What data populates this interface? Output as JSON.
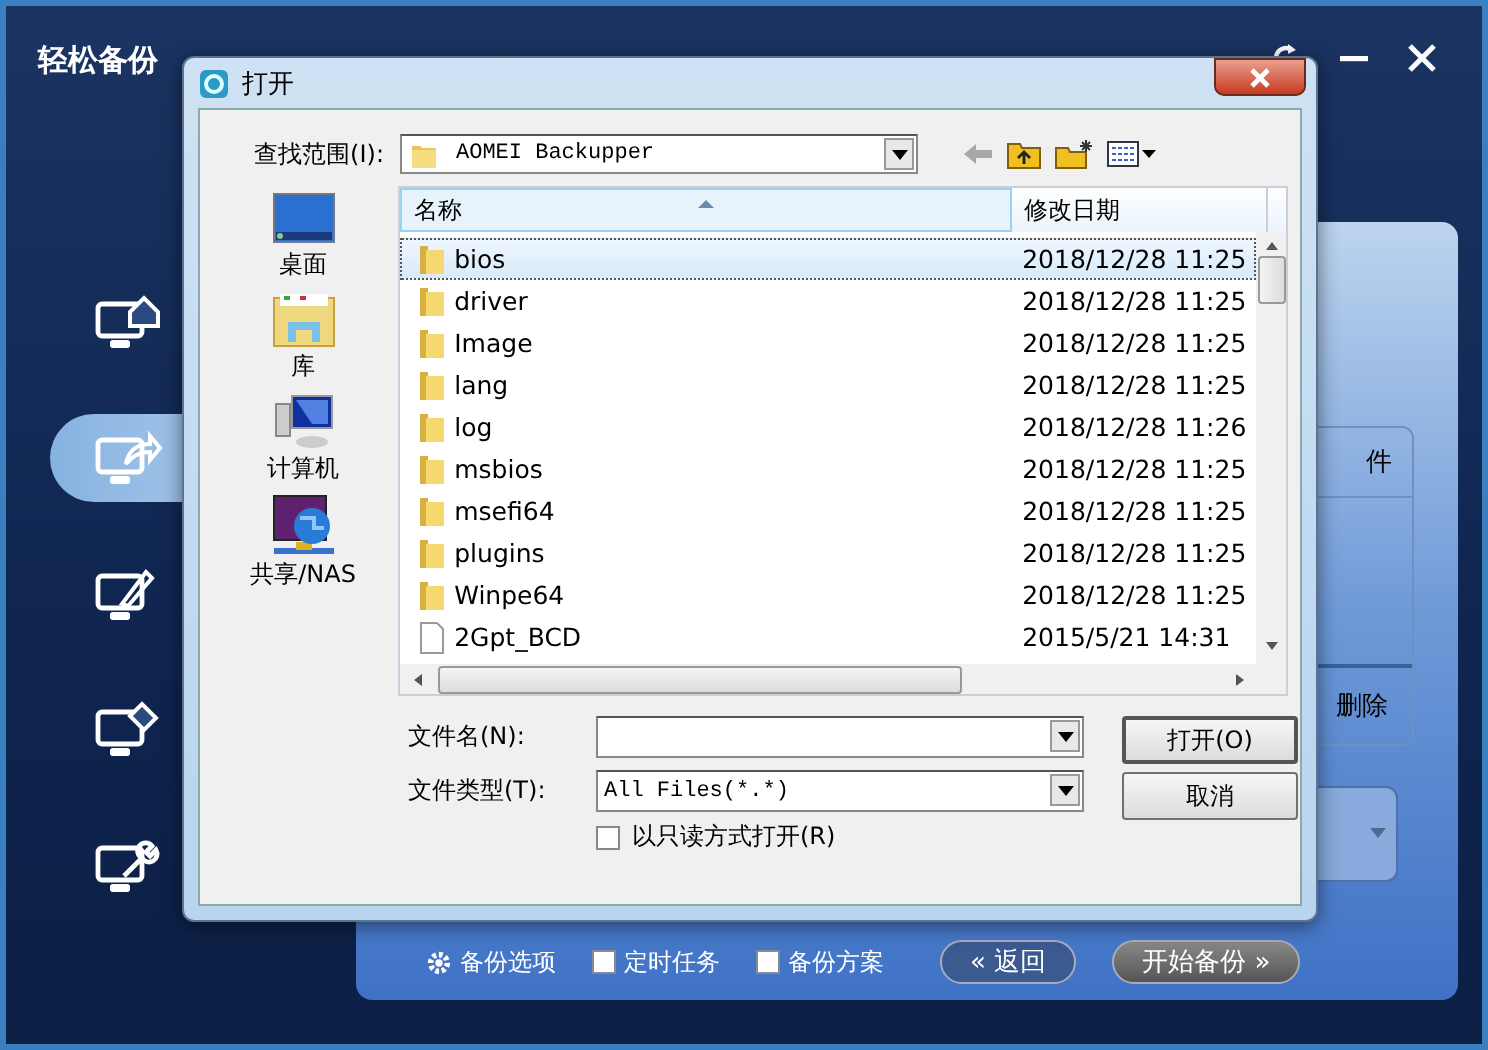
{
  "app": {
    "title": "轻松备份",
    "sidebar": [
      {
        "kind": "home",
        "selected": false
      },
      {
        "kind": "share",
        "selected": true
      },
      {
        "kind": "pen",
        "selected": false
      },
      {
        "kind": "eraser",
        "selected": false
      },
      {
        "kind": "wrench",
        "selected": false
      }
    ],
    "panel": {
      "column_header": "件",
      "action": "删除"
    },
    "bottom_bar": {
      "options": [
        {
          "kind": "gear",
          "label": "备份选项"
        },
        {
          "kind": "checkbox",
          "label": "定时任务",
          "checked": false
        },
        {
          "kind": "checkbox",
          "label": "备份方案",
          "checked": false
        }
      ],
      "back_button": "« 返回",
      "start_button": "开始备份 »"
    }
  },
  "dialog": {
    "title": "打开",
    "look_in_label": "查找范围(I):",
    "look_in_value": "AOMEI Backupper",
    "places": [
      {
        "kind": "desktop",
        "label": "桌面"
      },
      {
        "kind": "library",
        "label": "库"
      },
      {
        "kind": "computer",
        "label": "计算机"
      },
      {
        "kind": "network",
        "label": "共享/NAS"
      }
    ],
    "columns": [
      "名称",
      "修改日期"
    ],
    "files": [
      {
        "kind": "folder",
        "name": "bios",
        "date": "2018/12/28 11:25",
        "selected": true
      },
      {
        "kind": "folder",
        "name": "driver",
        "date": "2018/12/28 11:25",
        "selected": false
      },
      {
        "kind": "folder",
        "name": "Image",
        "date": "2018/12/28 11:25",
        "selected": false
      },
      {
        "kind": "folder",
        "name": "lang",
        "date": "2018/12/28 11:25",
        "selected": false
      },
      {
        "kind": "folder",
        "name": "log",
        "date": "2018/12/28 11:26",
        "selected": false
      },
      {
        "kind": "folder",
        "name": "msbios",
        "date": "2018/12/28 11:25",
        "selected": false
      },
      {
        "kind": "folder",
        "name": "msefi64",
        "date": "2018/12/28 11:25",
        "selected": false
      },
      {
        "kind": "folder",
        "name": "plugins",
        "date": "2018/12/28 11:25",
        "selected": false
      },
      {
        "kind": "folder",
        "name": "Winpe64",
        "date": "2018/12/28 11:25",
        "selected": false
      },
      {
        "kind": "file",
        "name": "2Gpt_BCD",
        "date": "2015/5/21 14:31",
        "selected": false
      }
    ],
    "filename_label": "文件名(N):",
    "filetype_label": "文件类型(T):",
    "filetype_value": "All Files(*.*)",
    "readonly": {
      "label": "以只读方式打开(R)",
      "checked": false
    },
    "buttons": [
      "打开(O)",
      "取消"
    ]
  }
}
